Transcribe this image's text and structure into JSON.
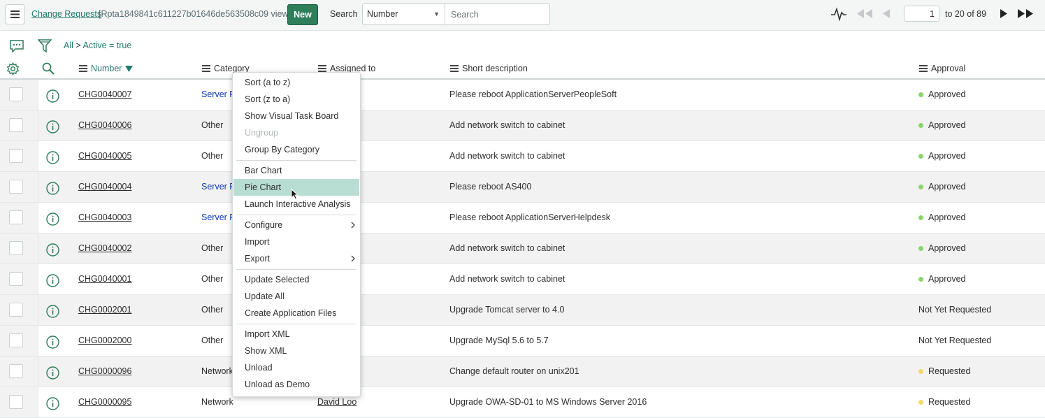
{
  "header": {
    "title": "Change Requests",
    "view_label": "[Rpta1849841c611227b01646de563508c09 view]",
    "new_label": "New",
    "search_label": "Search",
    "search_field": "Number",
    "search_placeholder": "Search",
    "page_value": "1",
    "page_range": "to 20 of 89"
  },
  "filter": {
    "all": "All",
    "separator": ">",
    "condition": "Active = true"
  },
  "columns": {
    "number": "Number",
    "category": "Category",
    "assigned": "Assigned to",
    "description": "Short description",
    "approval": "Approval"
  },
  "rows": [
    {
      "number": "CHG0040007",
      "category": "Server R",
      "assigned": "",
      "description": "Please reboot ApplicationServerPeopleSoft",
      "approval": "Approved",
      "approval_color": "#8bd36f"
    },
    {
      "number": "CHG0040006",
      "category": "Other",
      "assigned": "",
      "description": "Add network switch to cabinet",
      "approval": "Approved",
      "approval_color": "#8bd36f"
    },
    {
      "number": "CHG0040005",
      "category": "Other",
      "assigned": "",
      "description": "Add network switch to cabinet",
      "approval": "Approved",
      "approval_color": "#8bd36f"
    },
    {
      "number": "CHG0040004",
      "category": "Server R",
      "assigned": "",
      "description": "Please reboot AS400",
      "approval": "Approved",
      "approval_color": "#8bd36f"
    },
    {
      "number": "CHG0040003",
      "category": "Server R",
      "assigned": "",
      "description": "Please reboot ApplicationServerHelpdesk",
      "approval": "Approved",
      "approval_color": "#8bd36f"
    },
    {
      "number": "CHG0040002",
      "category": "Other",
      "assigned": "",
      "description": "Add network switch to cabinet",
      "approval": "Approved",
      "approval_color": "#8bd36f"
    },
    {
      "number": "CHG0040001",
      "category": "Other",
      "assigned": "",
      "description": "Add network switch to cabinet",
      "approval": "Approved",
      "approval_color": "#8bd36f"
    },
    {
      "number": "CHG0002001",
      "category": "Other",
      "assigned": "",
      "description": "Upgrade Tomcat server to 4.0",
      "approval": "Not Yet Requested",
      "approval_color": ""
    },
    {
      "number": "CHG0002000",
      "category": "Other",
      "assigned": "",
      "description": "Upgrade MySql 5.6 to 5.7",
      "approval": "Not Yet Requested",
      "approval_color": ""
    },
    {
      "number": "CHG0000096",
      "category": "Network",
      "assigned": "",
      "description": "Change default router on unix201",
      "approval": "Requested",
      "approval_color": "#f2d86b"
    },
    {
      "number": "CHG0000095",
      "category": "Network",
      "assigned": "David Loo",
      "description": "Upgrade OWA-SD-01 to MS Windows Server 2016",
      "approval": "Requested",
      "approval_color": "#f2d86b"
    }
  ],
  "context_menu": {
    "items": [
      "Sort (a to z)",
      "Sort (z to a)",
      "Show Visual Task Board",
      "Ungroup",
      "Group By Category",
      "Bar Chart",
      "Pie Chart",
      "Launch Interactive Analysis",
      "Configure",
      "Import",
      "Export",
      "Update Selected",
      "Update All",
      "Create Application Files",
      "Import XML",
      "Show XML",
      "Unload",
      "Unload as Demo"
    ]
  },
  "colors": {
    "accent": "#1f7b6b",
    "new_button": "#2e7d5b",
    "menu_highlight": "#b8ddd3",
    "approved": "#8bd36f",
    "requested": "#f2d86b"
  },
  "icons": [
    "hamburger-icon",
    "pulse-icon",
    "first-page-icon",
    "prev-page-icon",
    "next-page-icon",
    "last-page-icon",
    "chat-icon",
    "funnel-icon",
    "gear-icon",
    "search-icon",
    "column-menu-icon",
    "sort-desc-icon",
    "info-icon",
    "chevron-right-icon",
    "cursor-icon"
  ]
}
